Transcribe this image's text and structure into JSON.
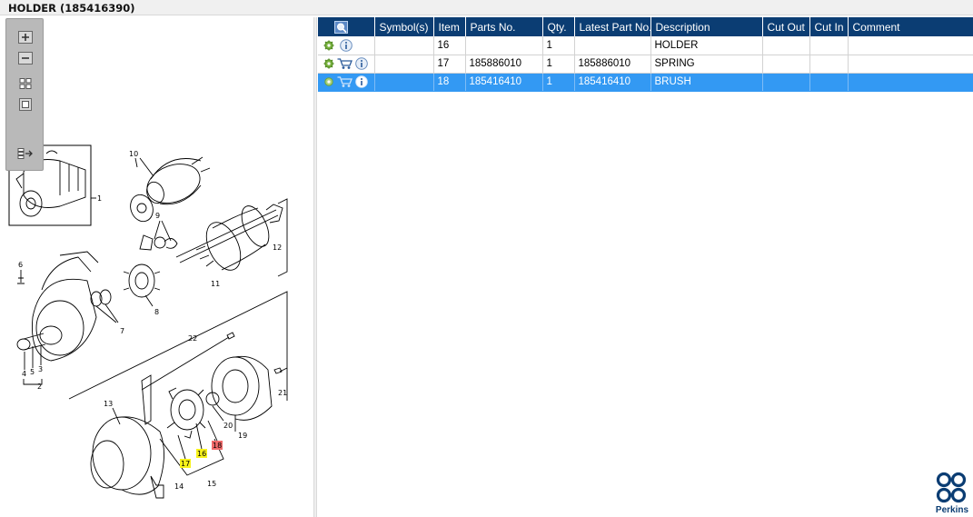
{
  "window": {
    "title": "HOLDER (185416390)"
  },
  "colors": {
    "header_bg": "#0b3d73",
    "selected_row": "#3399f3",
    "callout_yellow": "#f7f21a",
    "callout_red": "#f06a6a",
    "toolbar_bg": "#b9b9b9"
  },
  "toolbar": {
    "buttons": [
      {
        "name": "zoom-in",
        "icon": "zoom-in-icon"
      },
      {
        "name": "zoom-out",
        "icon": "zoom-out-icon"
      },
      {
        "name": "fit-all",
        "icon": "fit-all-icon"
      },
      {
        "name": "fit-window",
        "icon": "fit-window-icon"
      },
      {
        "name": "export",
        "icon": "export-icon"
      }
    ]
  },
  "drawing": {
    "callouts": [
      "1",
      "2",
      "3",
      "4",
      "5",
      "6",
      "7",
      "8",
      "9",
      "10",
      "11",
      "12",
      "13",
      "14",
      "15",
      "16",
      "17",
      "18",
      "19",
      "20",
      "21",
      "22"
    ],
    "highlighted": [
      {
        "label": "17",
        "color": "yellow"
      },
      {
        "label": "16",
        "color": "yellow"
      },
      {
        "label": "18",
        "color": "red"
      }
    ]
  },
  "table": {
    "header_icon": "search-parts-icon",
    "columns": [
      "Symbol(s)",
      "Item",
      "Parts No.",
      "Qty.",
      "Latest Part No.",
      "Description",
      "Cut Out",
      "Cut In",
      "Comment"
    ],
    "rows": [
      {
        "icons": [
          "gear-icon",
          "info-icon"
        ],
        "symbols": "",
        "item": "16",
        "parts_no": "",
        "qty": "1",
        "latest": "",
        "description": "HOLDER",
        "cut_out": "",
        "cut_in": "",
        "comment": ""
      },
      {
        "icons": [
          "gear-icon",
          "cart-icon",
          "info-icon"
        ],
        "symbols": "",
        "item": "17",
        "parts_no": "185886010",
        "qty": "1",
        "latest": "185886010",
        "description": "SPRING",
        "cut_out": "",
        "cut_in": "",
        "comment": ""
      },
      {
        "icons": [
          "gear-icon",
          "cart-icon",
          "info-icon"
        ],
        "symbols": "",
        "item": "18",
        "parts_no": "185416410",
        "qty": "1",
        "latest": "185416410",
        "description": "BRUSH",
        "cut_out": "",
        "cut_in": "",
        "comment": "",
        "selected": true
      }
    ]
  },
  "brand": {
    "name": "Perkins"
  }
}
